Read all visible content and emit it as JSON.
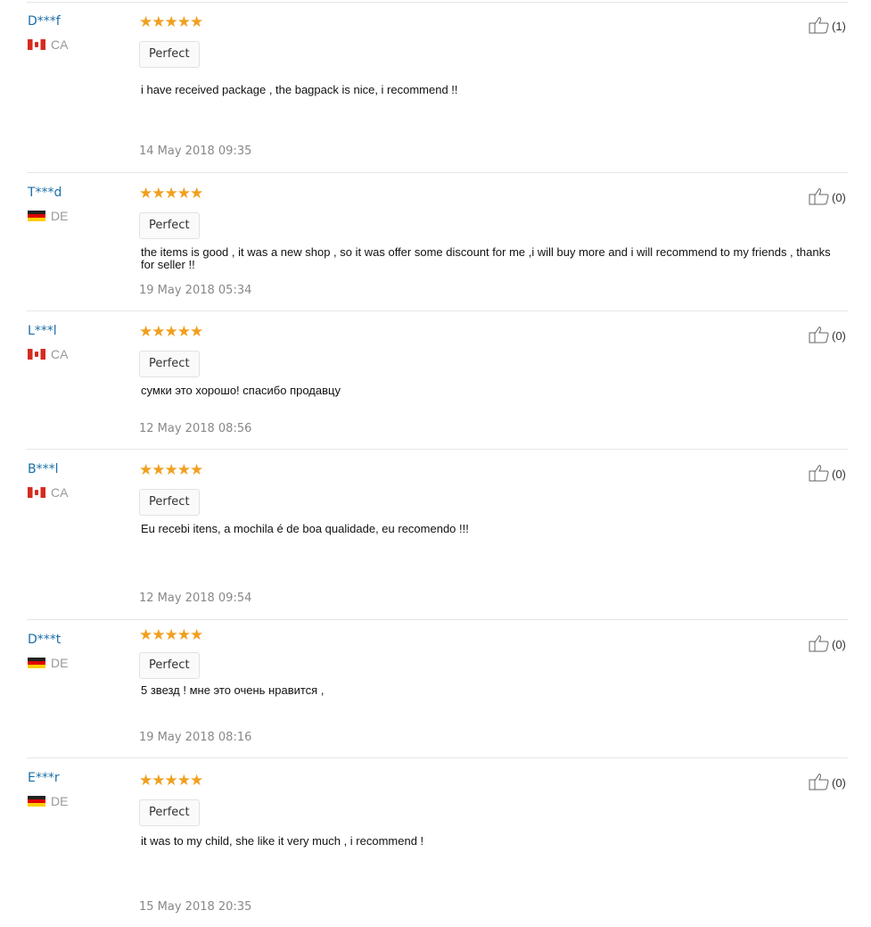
{
  "reviews": [
    {
      "user": "D***f",
      "country": "CA",
      "flag": "ca",
      "stars": "★★★★★",
      "badge": "Perfect",
      "text": "i have received package , the bagpack is nice, i recommend !!",
      "date": "14 May 2018 09:35",
      "likes": "(1)"
    },
    {
      "user": "T***d",
      "country": "DE",
      "flag": "de",
      "stars": "★★★★★",
      "badge": "Perfect",
      "text": "the items is good , it was a new shop , so it was offer some discount for me ,i will buy more and i will recommend to my friends , thanks for seller !!",
      "date": "19 May 2018 05:34",
      "likes": "(0)"
    },
    {
      "user": "L***l",
      "country": "CA",
      "flag": "ca",
      "stars": "★★★★★",
      "badge": "Perfect",
      "text": "сумки это хорошо! спасибо продавцу",
      "date": "12 May 2018 08:56",
      "likes": "(0)"
    },
    {
      "user": "B***l",
      "country": "CA",
      "flag": "ca",
      "stars": "★★★★★",
      "badge": "Perfect",
      "text": "Eu recebi itens, a mochila é de boa qualidade, eu recomendo !!!",
      "date": "12 May 2018 09:54",
      "likes": "(0)"
    },
    {
      "user": "D***t",
      "country": "DE",
      "flag": "de",
      "stars": "★★★★★",
      "badge": "Perfect",
      "text": "5 звезд ! мне это очень нравится ,",
      "date": "19 May 2018 08:16",
      "likes": "(0)"
    },
    {
      "user": "E***r",
      "country": "DE",
      "flag": "de",
      "stars": "★★★★★",
      "badge": "Perfect",
      "text": "it was to my child, she like it very much , i recommend !",
      "date": "15 May 2018 20:35",
      "likes": "(0)"
    }
  ],
  "colors": {
    "username": "#1a6fa8",
    "star": "#f0a020",
    "date": "#888888",
    "rule": "#e6e6e6"
  },
  "icons": {
    "like": "thumbs-up-icon"
  }
}
